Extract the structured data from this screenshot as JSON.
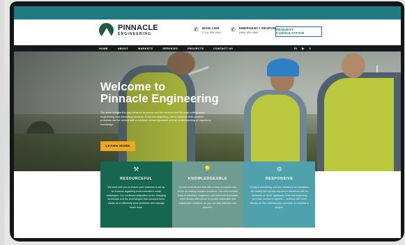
{
  "header": {
    "logo_name": "PINNACLE",
    "logo_sub": "ENGINEERING",
    "main_line_label": "MAIN LINE",
    "main_line_number": "(713) 555-4081",
    "emergency_label": "EMERGENCY RESPONSE",
    "emergency_number": "(866) 555-0865",
    "cta_label": "REQUEST CONSULTATION"
  },
  "nav": {
    "items": [
      "HOME",
      "ABOUT",
      "MARKETS",
      "SERVICES",
      "PROJECTS",
      "CONTACT US"
    ],
    "icons": [
      "linkedin-icon",
      "youtube-icon",
      "search-icon"
    ],
    "icon_glyphs": [
      "in",
      "▶",
      "⌕"
    ]
  },
  "hero": {
    "title_line1": "Welcome to",
    "title_line2": "Pinnacle Engineering",
    "description": "Our team bridges the gap between business and the environment through cutting-edge engineering and consulting services. From the beginning, we've believed that complex problems can be solved with a common-sense approach and an understanding of regulatory knowledge.",
    "button_label": "LEARN MORE"
  },
  "features": [
    {
      "icon": "tools-icon",
      "glyph": "⚒",
      "title": "RESOURCEFUL",
      "text": "We work with you to ensure your business is set up for success regarding environmental & social challenges. Our continued adaptation to the changing landscape and the technologies that surround them allows us to efficiently solve problems and manage future risks."
    },
    {
      "icon": "lightbulb-icon",
      "glyph": "💡",
      "title": "KNOWLEDGEABLE",
      "text": "We are a full-service firm with a team of experts who thrive on solving complex problems. Our well-rounded team of scientists, engineers, and technical specialists work directly with clients to provide actionable and sustainable solutions, so you can stay informed and assured."
    },
    {
      "icon": "gear-icon",
      "glyph": "⚙",
      "title": "RESPONSIVE",
      "text": "Timing is everything, and our industry is no exception. We readily and quickly respond to situations with an \"all hands on deck\" approach. From the beginning, you have access to experts — working with them directly as they address your concerns or complete a project."
    }
  ],
  "colors": {
    "teal": "#1f7a82",
    "nav_dark": "#171a1d",
    "cta_yellow": "#f0a81c",
    "card_green": "#176650",
    "card_sage": "#6e9c8e",
    "card_teal": "#4fa2ab"
  }
}
